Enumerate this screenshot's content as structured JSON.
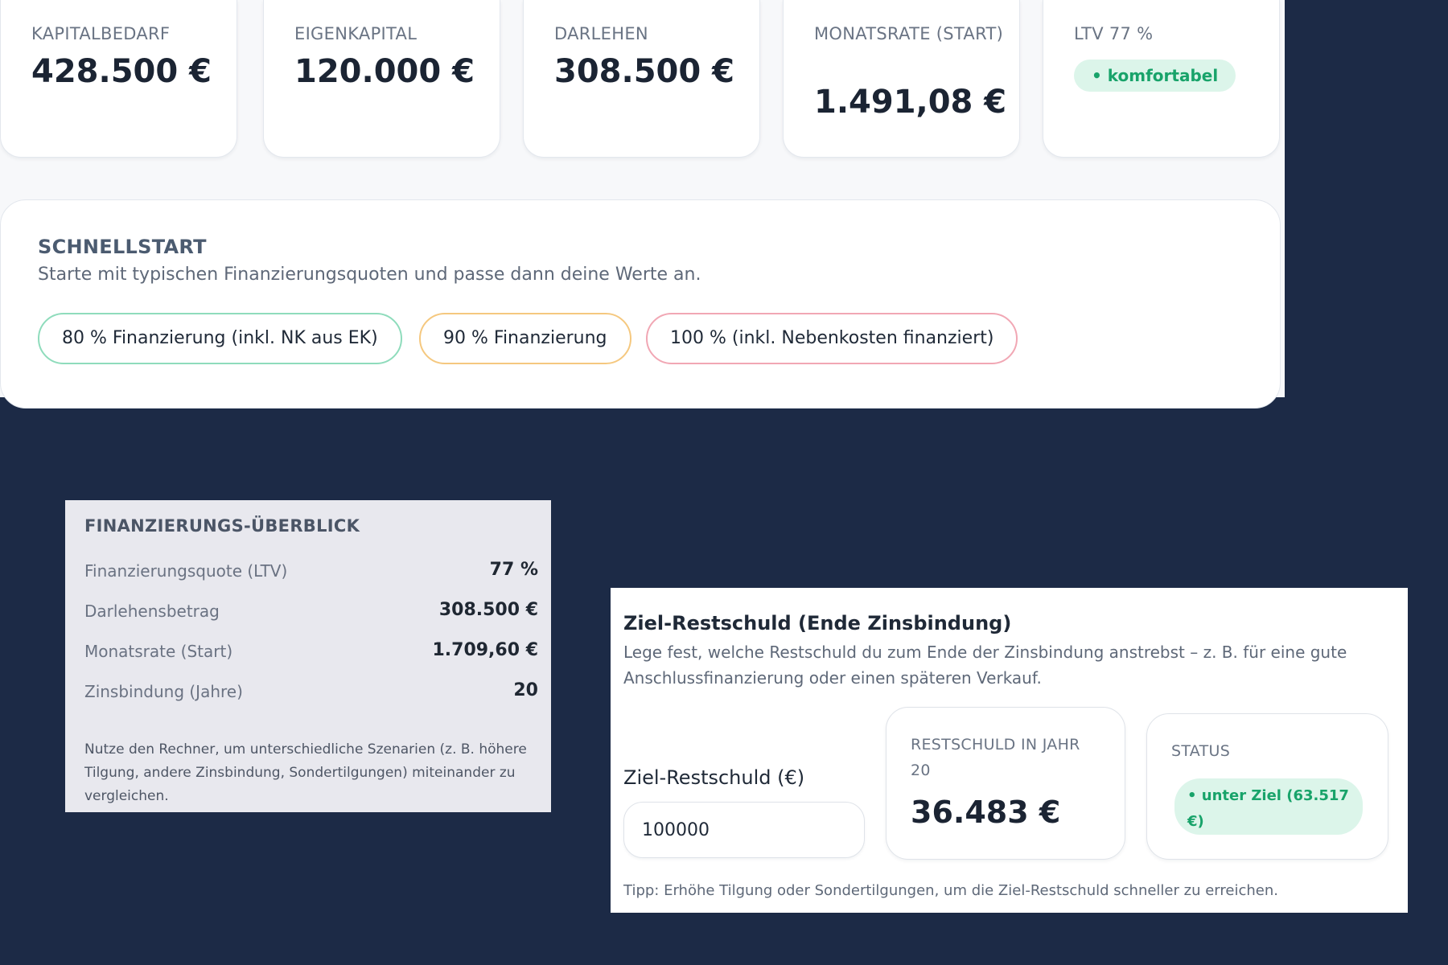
{
  "kpis": [
    {
      "label": "KAPITALBEDARF",
      "value": "428.500 €"
    },
    {
      "label": "EIGENKAPITAL",
      "value": "120.000 €"
    },
    {
      "label": "DARLEHEN",
      "value": "308.500 €"
    },
    {
      "label": "MONATSRATE (START)",
      "value": "1.491,08 €"
    },
    {
      "label": "LTV 77 %",
      "badge": "• komfortabel"
    }
  ],
  "quickstart": {
    "title": "SCHNELLSTART",
    "description": "Starte mit typischen Finanzierungsquoten und passe dann deine Werte an.",
    "buttons": [
      "80 % Finanzierung (inkl. NK aus EK)",
      "90 % Finanzierung",
      "100 % (inkl. Nebenkosten finanziert)"
    ]
  },
  "overview": {
    "title": "FINANZIERUNGS-ÜBERBLICK",
    "rows": [
      {
        "label": "Finanzierungsquote (LTV)",
        "value": "77 %"
      },
      {
        "label": "Darlehensbetrag",
        "value": "308.500 €"
      },
      {
        "label": "Monatsrate (Start)",
        "value": "1.709,60 €"
      },
      {
        "label": "Zinsbindung (Jahre)",
        "value": "20"
      }
    ],
    "note": "Nutze den Rechner, um unterschiedliche Szenarien (z. B. höhere Tilgung, andere Zinsbindung, Sondertilgungen) miteinander zu vergleichen."
  },
  "target": {
    "title": "Ziel-Restschuld (Ende Zinsbindung)",
    "description": "Lege fest, welche Restschuld du zum Ende der Zinsbindung anstrebst – z. B. für eine gute Anschlussfinanzierung oder einen späteren Verkauf.",
    "input_label": "Ziel-Restschuld (€)",
    "input_value": "100000",
    "rest_label": "RESTSCHULD IN JAHR 20",
    "rest_value": "36.483 €",
    "status_label": "STATUS",
    "status_badge": "• unter Ziel (63.517 €)",
    "tip": "Tipp: Erhöhe Tilgung oder Sondertilgungen, um die Ziel-Restschuld schneller zu erreichen."
  }
}
